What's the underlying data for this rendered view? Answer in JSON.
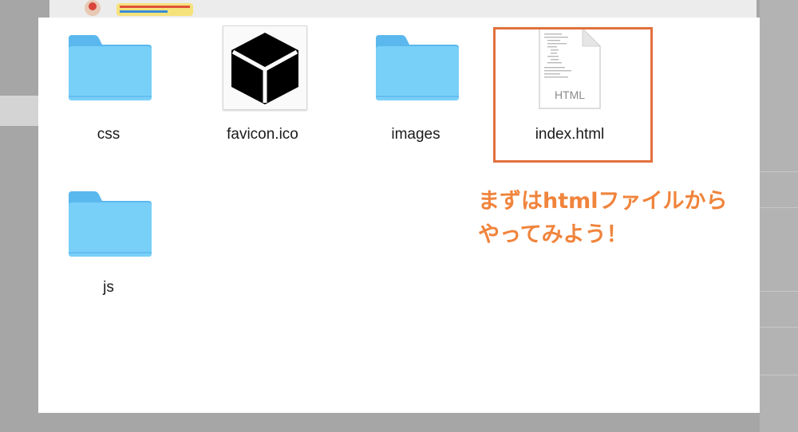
{
  "files": [
    {
      "name": "css",
      "kind": "folder"
    },
    {
      "name": "favicon.ico",
      "kind": "icon-file"
    },
    {
      "name": "images",
      "kind": "folder"
    },
    {
      "name": "index.html",
      "kind": "html-file",
      "badge": "HTML",
      "selected": true
    },
    {
      "name": "js",
      "kind": "folder"
    }
  ],
  "callout": {
    "line1": "まずはhtmlファイルから",
    "line2": "やってみよう！"
  },
  "colors": {
    "folder": "#6cc7f5",
    "highlight": "#e2703d",
    "callout_text": "#f0843c"
  },
  "icons": [
    "folder-icon",
    "favicon-cube-icon",
    "html-document-icon"
  ]
}
